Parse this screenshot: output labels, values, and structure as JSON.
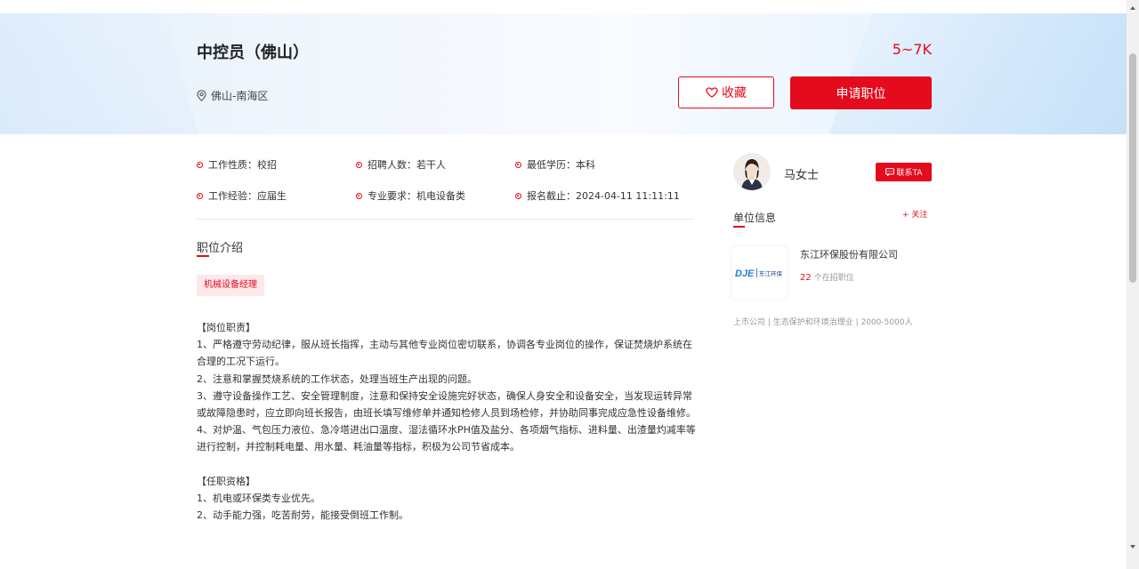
{
  "header": {
    "job_title": "中控员（佛山）",
    "salary": "5~7K",
    "location": "佛山-南海区",
    "favorite_label": "收藏",
    "apply_label": "申请职位"
  },
  "attributes": [
    {
      "label": "工作性质：",
      "value": "校招"
    },
    {
      "label": "招聘人数：",
      "value": "若干人"
    },
    {
      "label": "最低学历：",
      "value": "本科"
    },
    {
      "label": "工作经验：",
      "value": "应届生"
    },
    {
      "label": "专业要求：",
      "value": "机电设备类"
    },
    {
      "label": "报名截止：",
      "value": "2024-04-11 11:11:11"
    }
  ],
  "description": {
    "section_title": "职位介绍",
    "tag": "机械设备经理",
    "lines": [
      "【岗位职责】",
      "1、严格遵守劳动纪律，服从班长指挥，主动与其他专业岗位密切联系，协调各专业岗位的操作，保证焚烧炉系统在合理的工况下运行。",
      "2、注意和掌握焚烧系统的工作状态，处理当班生产出现的问题。",
      "3、遵守设备操作工艺、安全管理制度，注意和保持安全设施完好状态，确保人身安全和设备安全，当发现运转异常或故障隐患时，应立即向班长报告，由班长填写维修单并通知检修人员到场检修，并协助同事完成应急性设备维修。",
      "4、对炉温、气包压力液位、急冷塔进出口温度、湿法循环水PH值及盐分、各项烟气指标、进料量、出渣量灼减率等进行控制，并控制耗电量、用水量、耗油量等指标，积极为公司节省成本。",
      "",
      "【任职资格】",
      "1、机电或环保类专业优先。",
      "2、动手能力强，吃苦耐劳，能接受倒班工作制。"
    ]
  },
  "sidebar": {
    "contact_name": "马女士",
    "contact_button": "联系TA",
    "unit_title": "单位信息",
    "follow_label": "+ 关注",
    "logo_text": "东江环保",
    "company_name": "东江环保股份有限公司",
    "jobs_count": "22",
    "jobs_suffix": "个在招职位",
    "company_meta": "上市公司 | 生态保护和环境治理业 | 2000-5000人"
  },
  "colors": {
    "accent": "#e30b1c",
    "tag_bg": "#fde8ea"
  }
}
